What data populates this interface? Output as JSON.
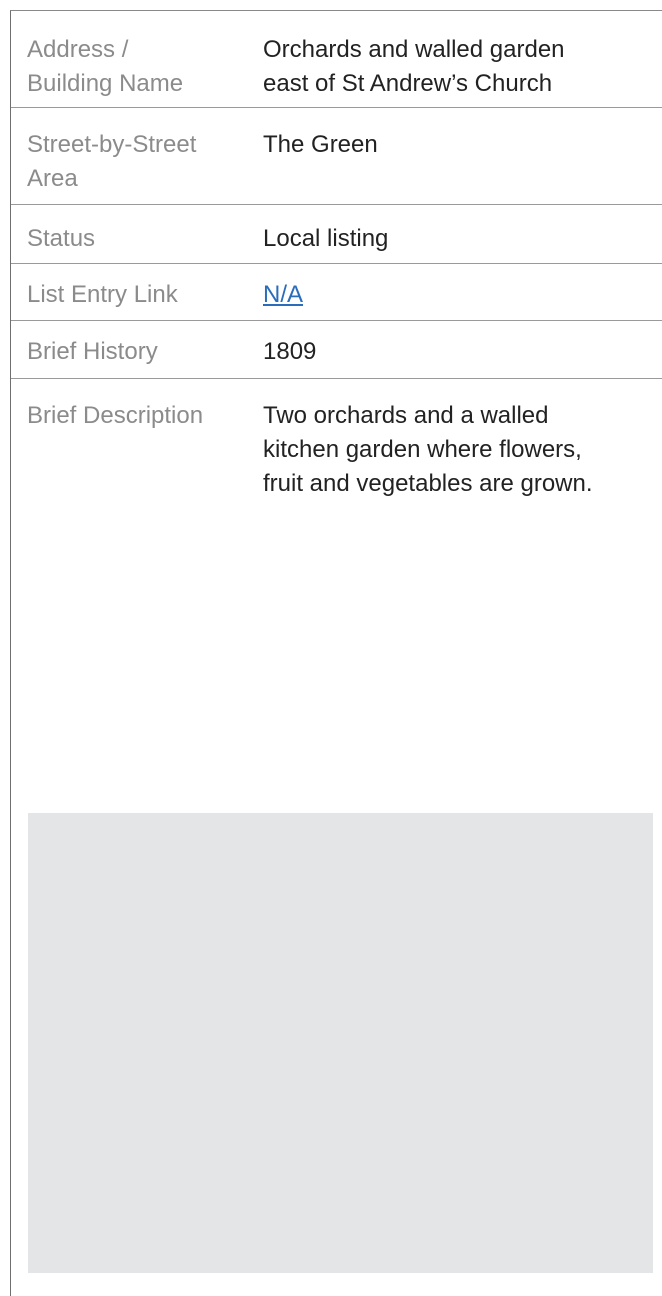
{
  "rows": [
    {
      "label": "Address / Building Name",
      "label_lines": [
        "Address /",
        "Building Name"
      ],
      "value_lines": [
        "Orchards and walled garden",
        "east of St Andrew’s Church"
      ]
    },
    {
      "label_lines": [
        "Street-by-Street",
        "Area"
      ],
      "value_lines": [
        "The Green"
      ]
    },
    {
      "label_lines": [
        "Status"
      ],
      "value_lines": [
        "Local listing"
      ]
    },
    {
      "label_lines": [
        "List Entry Link"
      ],
      "link_text": "N/A"
    },
    {
      "label_lines": [
        "Brief History"
      ],
      "value_lines": [
        "1809"
      ]
    },
    {
      "label_lines": [
        "Brief Description"
      ],
      "value_lines": [
        "Two orchards and a walled",
        "kitchen garden where flowers,",
        "fruit and vegetables are grown."
      ]
    }
  ],
  "colors": {
    "label_text": "#8b8b8b",
    "value_text": "#222222",
    "link": "#2a6ebb",
    "image_placeholder": "#e4e5e7",
    "row_divider": "#9a9a9a"
  }
}
